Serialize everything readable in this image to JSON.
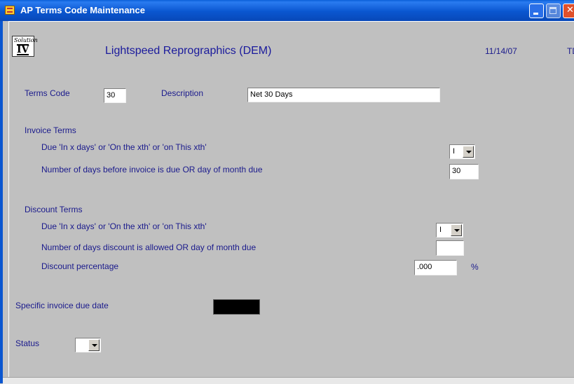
{
  "window": {
    "title": "AP Terms Code Maintenance"
  },
  "header": {
    "logo_script": "Solution",
    "logo_text": "IV",
    "company": "Lightspeed Reprographics (DEM)",
    "date": "11/14/07",
    "operator": "TD"
  },
  "form": {
    "terms_code": {
      "label": "Terms Code",
      "value": "30"
    },
    "description": {
      "label": "Description",
      "value": "Net 30 Days"
    },
    "invoice_terms": {
      "heading": "Invoice Terms",
      "due_type_label": "Due 'In x days' or 'On the xth' or 'on This xth'",
      "due_type_value": "I",
      "days_label": "Number of days before invoice is due OR day of month due",
      "days_value": "30"
    },
    "discount_terms": {
      "heading": "Discount Terms",
      "due_type_label": "Due 'In x days' or 'On the xth' or 'on This xth'",
      "due_type_value": "I",
      "days_label": "Number of days discount is allowed OR day of month due",
      "days_value": "",
      "percent_label": "Discount percentage",
      "percent_value": ".000",
      "percent_symbol": "%"
    },
    "due_date": {
      "label": "Specific invoice due date",
      "value": ""
    },
    "status": {
      "label": "Status",
      "value": ""
    }
  }
}
